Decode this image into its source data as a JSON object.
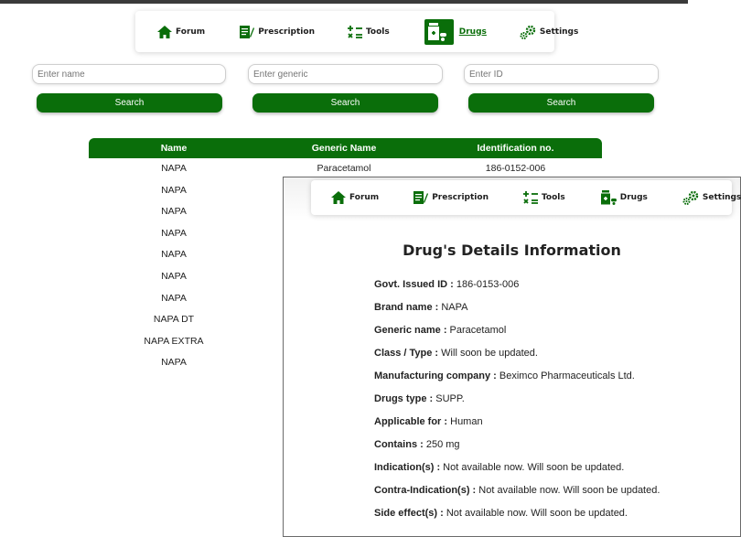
{
  "nav": {
    "items": [
      {
        "label": "Forum",
        "icon": "home-icon"
      },
      {
        "label": "Prescription",
        "icon": "prescription-icon"
      },
      {
        "label": "Tools",
        "icon": "calculator-icon"
      },
      {
        "label": "Drugs",
        "icon": "drugs-icon"
      },
      {
        "label": "Settings",
        "icon": "gears-icon"
      }
    ],
    "active": "Drugs"
  },
  "search": {
    "name_placeholder": "Enter name",
    "generic_placeholder": "Enter generic",
    "id_placeholder": "Enter ID",
    "button_label": "Search"
  },
  "table": {
    "headers": [
      "Name",
      "Generic Name",
      "Identification no."
    ],
    "rows": [
      {
        "name": "NAPA",
        "generic": "Paracetamol",
        "id": "186-0152-006"
      },
      {
        "name": "NAPA"
      },
      {
        "name": "NAPA"
      },
      {
        "name": "NAPA"
      },
      {
        "name": "NAPA"
      },
      {
        "name": "NAPA"
      },
      {
        "name": "NAPA"
      },
      {
        "name": "NAPA DT"
      },
      {
        "name": "NAPA EXTRA"
      },
      {
        "name": "NAPA"
      }
    ]
  },
  "detail": {
    "title": "Drug's Details Information",
    "fields": [
      {
        "label": "Govt. Issued ID :",
        "value": "186-0153-006"
      },
      {
        "label": "Brand name :",
        "value": "NAPA"
      },
      {
        "label": "Generic name :",
        "value": "Paracetamol"
      },
      {
        "label": "Class / Type :",
        "value": "Will soon be updated."
      },
      {
        "label": "Manufacturing company :",
        "value": "Beximco Pharmaceuticals Ltd."
      },
      {
        "label": "Drugs type :",
        "value": "SUPP."
      },
      {
        "label": "Applicable for :",
        "value": "Human"
      },
      {
        "label": "Contains :",
        "value": "250 mg"
      },
      {
        "label": "Indication(s) :",
        "value": "Not available now. Will soon be updated."
      },
      {
        "label": "Contra-Indication(s) :",
        "value": "Not available now. Will soon be updated."
      },
      {
        "label": "Side effect(s) :",
        "value": "Not available now. Will soon be updated."
      }
    ]
  },
  "colors": {
    "accent": "#0a6e0a"
  }
}
